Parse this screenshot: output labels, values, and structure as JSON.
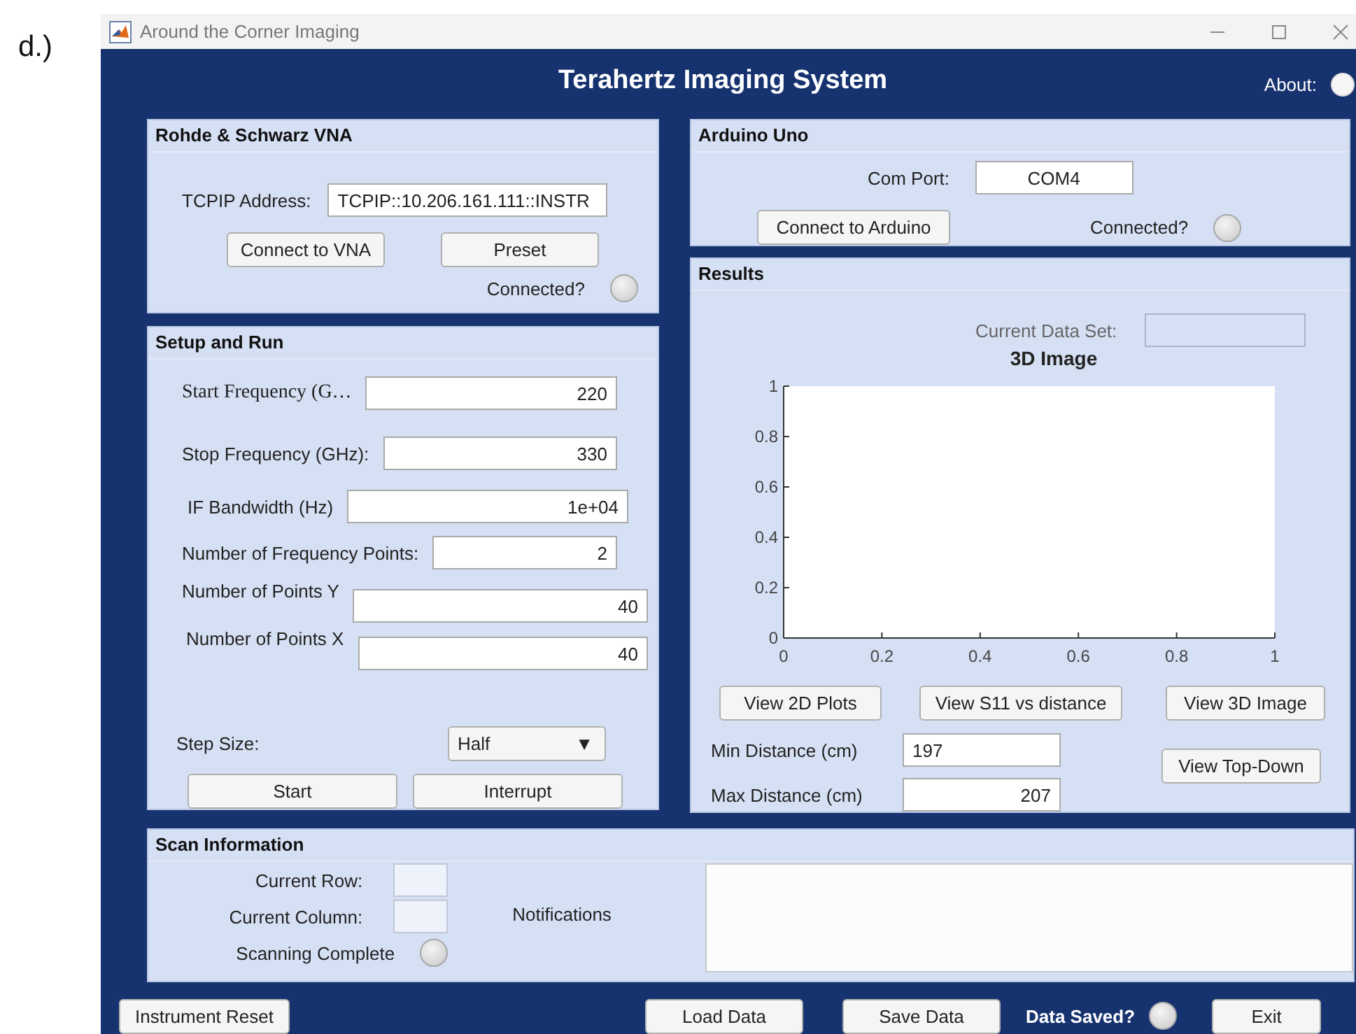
{
  "figure_label": "d.)",
  "window": {
    "title": "Around the Corner Imaging"
  },
  "header": {
    "title": "Terahertz Imaging System",
    "about": {
      "label": "About:",
      "on": false
    }
  },
  "vna": {
    "title": "Rohde & Schwarz VNA",
    "address": {
      "label": "TCPIP Address:",
      "value": "TCPIP::10.206.161.111::INSTR"
    },
    "buttons": [
      "Connect to VNA",
      "Preset"
    ],
    "status": {
      "label": "Connected?",
      "on": false
    }
  },
  "setup": {
    "title": "Setup and Run",
    "fields": [
      {
        "label": "Start Frequency (G…",
        "value": "220"
      },
      {
        "label": "Stop Frequency (GHz):",
        "value": "330"
      },
      {
        "label": "IF Bandwidth (Hz)",
        "value": "1e+04"
      },
      {
        "label": "Number of Frequency Points:",
        "value": "2"
      },
      {
        "label": "Number of Points Y",
        "value": "40"
      },
      {
        "label": "Number of Points X",
        "value": "40"
      }
    ],
    "step_size": {
      "label": "Step Size:",
      "value": "Half",
      "arrow": "▼"
    },
    "buttons": [
      "Start",
      "Interrupt"
    ]
  },
  "arduino": {
    "title": "Arduino Uno",
    "com_port": {
      "label": "Com Port:",
      "value": "COM4"
    },
    "button": "Connect to Arduino",
    "status": {
      "label": "Connected?",
      "on": false
    }
  },
  "results": {
    "title": "Results",
    "data_set": {
      "label": "Current Data Set:",
      "disabled": true
    },
    "chart_data": {
      "type": "line",
      "title": "3D Image",
      "xlim": [
        0,
        1
      ],
      "ylim": [
        0,
        1
      ],
      "xticks": [
        0,
        0.2,
        0.4,
        0.6,
        0.8,
        1
      ],
      "yticks": [
        0,
        0.2,
        0.4,
        0.6,
        0.8,
        1
      ]
    },
    "view_buttons": [
      "View 2D Plots",
      "View S11 vs distance",
      "View 3D Image"
    ],
    "min_distance": {
      "label": "Min Distance (cm)",
      "value": "197"
    },
    "max_distance": {
      "label": "Max Distance (cm)",
      "value": "207"
    },
    "top_down_button": "View Top-Down"
  },
  "scan_info": {
    "title": "Scan Information",
    "current_row": {
      "label": "Current Row:"
    },
    "current_column": {
      "label": "Current Column:"
    },
    "complete": {
      "label": "Scanning Complete",
      "on": false
    },
    "notifications": {
      "label": "Notifications"
    }
  },
  "footer": {
    "reset_button": "Instrument Reset",
    "load_button": "Load Data",
    "save_button": "Save Data",
    "saved": {
      "label": "Data Saved?",
      "on": false
    },
    "exit_button": "Exit"
  }
}
